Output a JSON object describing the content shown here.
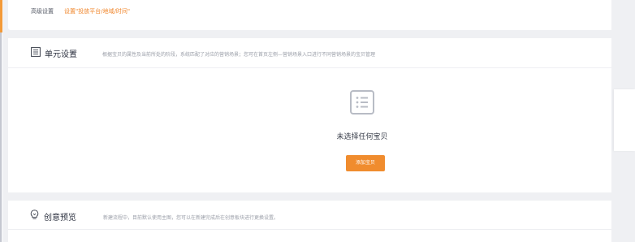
{
  "advanced": {
    "label": "高级设置",
    "link_text": "设置\"投放平台/地域/时间\""
  },
  "unit": {
    "title": "单元设置",
    "description": "根据宝贝的属性及当前所处的阶段，系统匹配了对应的营销场景；您可在首页左侧—营销场景入口进行不同营销场景的宝贝管理",
    "empty_text": "未选择任何宝贝",
    "add_button": "添加宝贝"
  },
  "creative": {
    "title": "创意预览",
    "description": "新建流程中，目前默认使用主图，您可以在新建完成后在创意板块进行更换设置。"
  },
  "colors": {
    "accent": "#f08c2e",
    "background": "#eff0f3"
  },
  "icons": {
    "unit": "list-document-icon",
    "empty": "list-document-icon",
    "creative": "lightbulb-icon"
  }
}
